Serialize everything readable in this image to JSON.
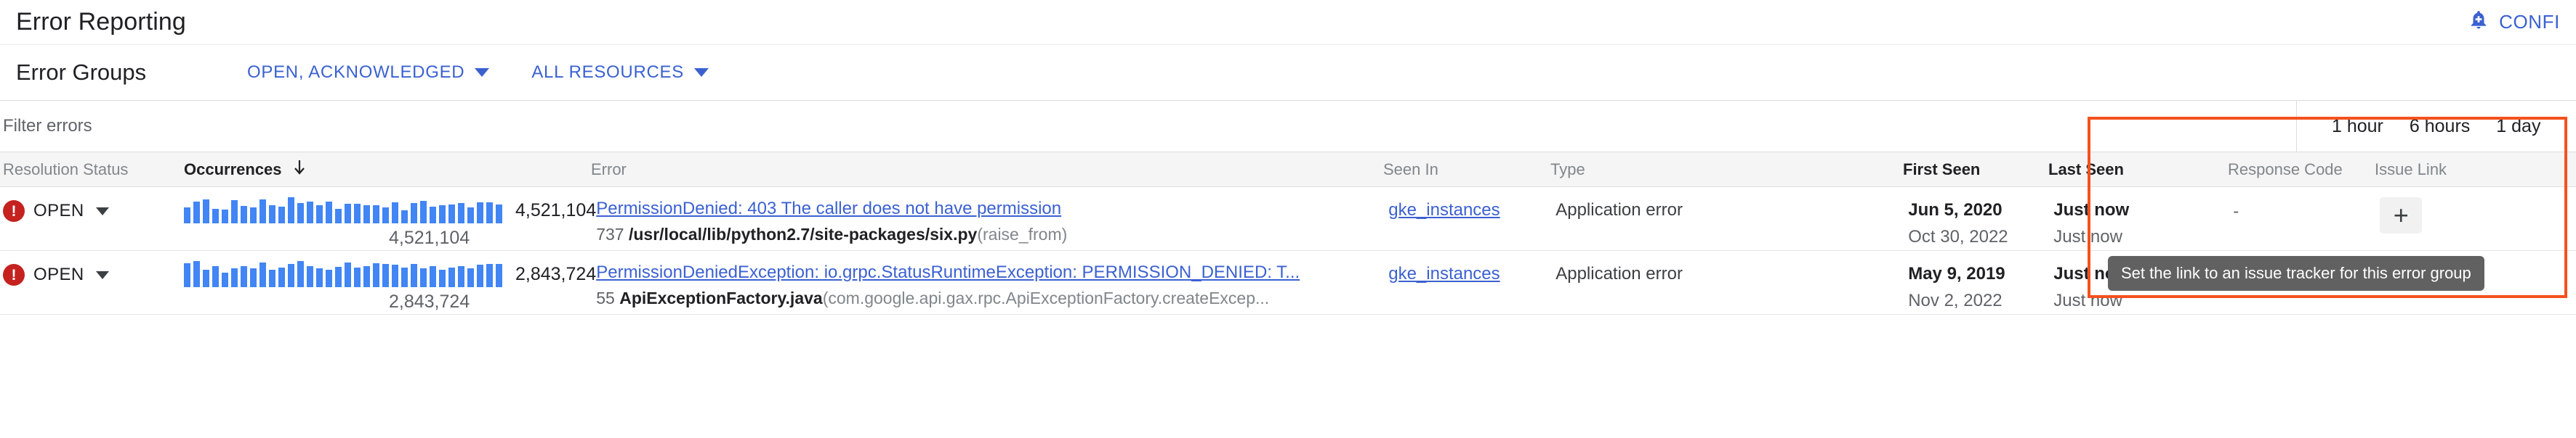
{
  "header": {
    "title": "Error Reporting",
    "configure_label": "CONFI",
    "bell_icon": "bell-plus-icon"
  },
  "sub_header": {
    "section_title": "Error Groups",
    "filters": [
      {
        "label": "OPEN, ACKNOWLEDGED",
        "icon": "chevron-down-icon"
      },
      {
        "label": "ALL RESOURCES",
        "icon": "chevron-down-icon"
      }
    ]
  },
  "filter_bar": {
    "placeholder": "Filter errors",
    "value": "",
    "time_ranges": [
      "1 hour",
      "6 hours",
      "1 day"
    ]
  },
  "table": {
    "columns": [
      {
        "key": "resolution_status",
        "label": "Resolution Status",
        "emphasis": "muted"
      },
      {
        "key": "occurrences",
        "label": "Occurrences",
        "emphasis": "dark",
        "sort": "desc",
        "sort_icon": "arrow-down-icon"
      },
      {
        "key": "error",
        "label": "Error",
        "emphasis": "muted"
      },
      {
        "key": "seen_in",
        "label": "Seen In",
        "emphasis": "muted"
      },
      {
        "key": "type",
        "label": "Type",
        "emphasis": "muted"
      },
      {
        "key": "first_seen",
        "label": "First Seen",
        "emphasis": "dark"
      },
      {
        "key": "last_seen",
        "label": "Last Seen",
        "emphasis": "dark"
      },
      {
        "key": "response_code",
        "label": "Response Code",
        "emphasis": "muted"
      },
      {
        "key": "issue_link",
        "label": "Issue Link",
        "emphasis": "muted"
      }
    ],
    "rows": [
      {
        "status": "OPEN",
        "status_icon": "error-circle-icon",
        "occurrences": "4,521,104",
        "occurrences_sub": "4,521,104",
        "sparkline": [
          22,
          30,
          33,
          20,
          19,
          32,
          24,
          22,
          33,
          25,
          23,
          36,
          28,
          30,
          25,
          30,
          20,
          27,
          27,
          25,
          25,
          22,
          29,
          18,
          28,
          31,
          23,
          25,
          26,
          28,
          22,
          29,
          29,
          26
        ],
        "error_title": "PermissionDenied: 403 The caller does not have permission",
        "error_line": "737",
        "error_file": "/usr/local/lib/python2.7/site-packages/six.py",
        "error_fn": "(raise_from)",
        "seen_in": "gke_instances",
        "type": "Application error",
        "first_seen_top": "Jun 5, 2020",
        "first_seen_bottom": "Oct 30, 2022",
        "last_seen_top": "Just now",
        "last_seen_bottom": "Just now",
        "response_code": "-",
        "issue_link_icon": "plus-icon"
      },
      {
        "status": "OPEN",
        "status_icon": "error-circle-icon",
        "occurrences": "2,843,724",
        "occurrences_sub": "2,843,724",
        "sparkline": [
          30,
          33,
          22,
          27,
          18,
          24,
          27,
          24,
          31,
          22,
          25,
          29,
          33,
          27,
          24,
          22,
          26,
          31,
          25,
          27,
          30,
          29,
          28,
          25,
          29,
          24,
          27,
          22,
          25,
          27,
          24,
          28,
          29,
          29
        ],
        "error_title": "PermissionDeniedException: io.grpc.StatusRuntimeException: PERMISSION_DENIED: T...",
        "error_line": "55",
        "error_file": "ApiExceptionFactory.java",
        "error_fn": "(com.google.api.gax.rpc.ApiExceptionFactory.createExcep...",
        "seen_in": "gke_instances",
        "type": "Application error",
        "first_seen_top": "May 9, 2019",
        "first_seen_bottom": "Nov 2, 2022",
        "last_seen_top": "Just now",
        "last_seen_bottom": "Just now",
        "response_code": "-",
        "issue_link_icon": "plus-icon"
      }
    ]
  },
  "tooltip": {
    "text": "Set the link to an issue tracker for this error group"
  },
  "annotation": {
    "highlight_color": "#f4511e"
  },
  "colors": {
    "link": "#3b61d1",
    "accent_blue": "#4285f4",
    "error_red": "#c5221f",
    "highlight": "#f4511e",
    "tooltip_bg": "#616161"
  }
}
